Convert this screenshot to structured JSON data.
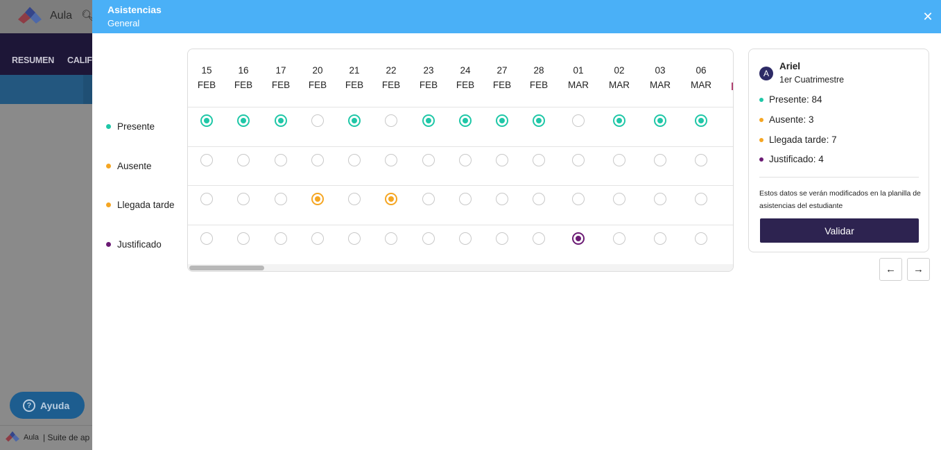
{
  "background": {
    "app_name": "Aula",
    "nav_items": [
      "RESUMEN",
      "CALIF"
    ],
    "help_label": "Ayuda",
    "footer_brand": "Aula",
    "footer_text": "| Suite de ap"
  },
  "modal": {
    "title": "Asistencias",
    "subtitle": "General",
    "close_icon": "close-icon"
  },
  "rows": [
    {
      "label": "Presente",
      "color": "#1fc7a7"
    },
    {
      "label": "Ausente",
      "color": "#f5a623"
    },
    {
      "label": "Llegada tarde",
      "color": "#f5a623"
    },
    {
      "label": "Justificado",
      "color": "#6b1b74"
    }
  ],
  "dates": [
    {
      "day": "15",
      "month": "FEB",
      "status": "present"
    },
    {
      "day": "16",
      "month": "FEB",
      "status": "present"
    },
    {
      "day": "17",
      "month": "FEB",
      "status": "present"
    },
    {
      "day": "20",
      "month": "FEB",
      "status": "late"
    },
    {
      "day": "21",
      "month": "FEB",
      "status": "present"
    },
    {
      "day": "22",
      "month": "FEB",
      "status": "late"
    },
    {
      "day": "23",
      "month": "FEB",
      "status": "present"
    },
    {
      "day": "24",
      "month": "FEB",
      "status": "present"
    },
    {
      "day": "27",
      "month": "FEB",
      "status": "present"
    },
    {
      "day": "28",
      "month": "FEB",
      "status": "present"
    },
    {
      "day": "01",
      "month": "MAR",
      "status": "justified"
    },
    {
      "day": "02",
      "month": "MAR",
      "status": "present"
    },
    {
      "day": "03",
      "month": "MAR",
      "status": "present"
    },
    {
      "day": "06",
      "month": "MAR",
      "status": "present"
    }
  ],
  "student": {
    "initial": "A",
    "name": "Ariel",
    "period": "1er Cuatrimestre",
    "stats": [
      {
        "label": "Presente: 84",
        "color": "#1fc7a7"
      },
      {
        "label": "Ausente: 3",
        "color": "#f5a623"
      },
      {
        "label": "Llegada tarde: 7",
        "color": "#f5a623"
      },
      {
        "label": "Justificado: 4",
        "color": "#6b1b74"
      }
    ],
    "note": "Estos datos se verán modificados en la planilla de asistencias del estudiante",
    "validate_label": "Validar"
  },
  "navigation": {
    "prev_icon": "arrow-left-icon",
    "next_icon": "arrow-right-icon"
  }
}
